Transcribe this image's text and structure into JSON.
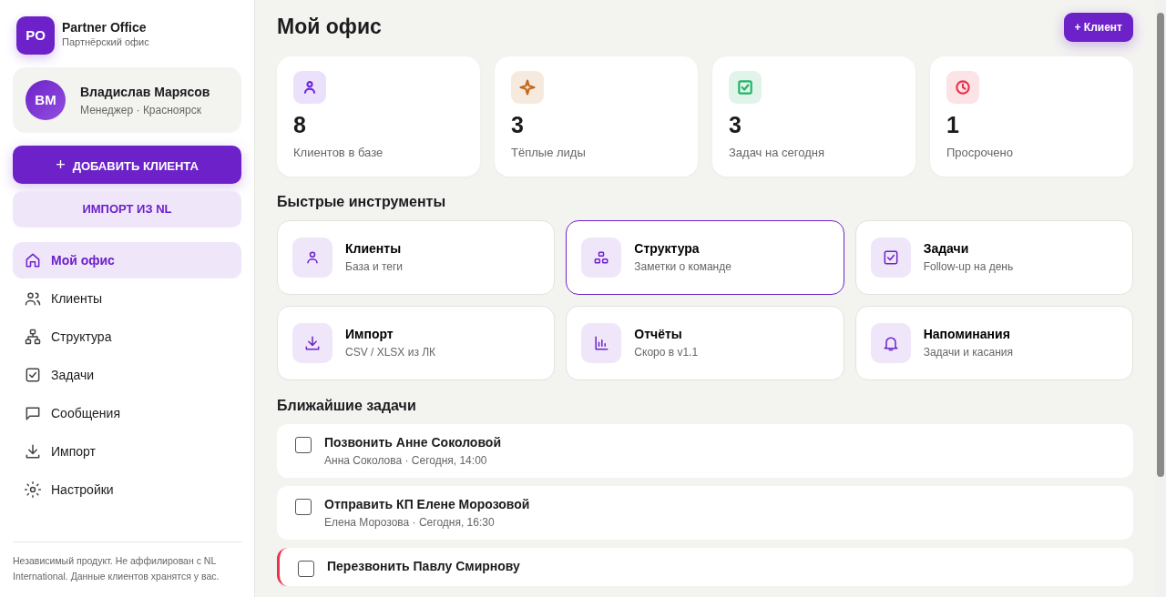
{
  "brand": {
    "logo": "PO",
    "name": "Partner Office",
    "subtitle": "Партнёрский офис"
  },
  "user": {
    "initials": "ВМ",
    "name": "Владислав Марясов",
    "role": "Менеджер · Красноярск"
  },
  "add_client_button": {
    "icon": "+",
    "label": "ДОБАВИТЬ КЛИЕНТА"
  },
  "import_button": {
    "label": "ИМПОРТ ИЗ NL"
  },
  "nav": [
    {
      "label": "Мой офис",
      "selected": true
    },
    {
      "label": "Клиенты",
      "selected": false
    },
    {
      "label": "Структура",
      "selected": false
    },
    {
      "label": "Задачи",
      "selected": false
    },
    {
      "label": "Сообщения",
      "selected": false
    },
    {
      "label": "Импорт",
      "selected": false
    },
    {
      "label": "Настройки",
      "selected": false
    }
  ],
  "disclaimer": "Независимый продукт. Не аффилирован с NL International. Данные клиентов хранятся у вас.",
  "page_title": "Мой офис",
  "header_button": "+ Клиент",
  "stats": [
    {
      "value": "8",
      "label": "Клиентов в базе",
      "color": "#6d28d9"
    },
    {
      "value": "3",
      "label": "Тёплые лиды",
      "color": "#c2691a"
    },
    {
      "value": "3",
      "label": "Задач на сегодня",
      "color": "#22b366"
    },
    {
      "value": "1",
      "label": "Просрочено",
      "color": "#e8344e"
    }
  ],
  "tools_title": "Быстрые инструменты",
  "tools": [
    {
      "title": "Клиенты",
      "subtitle": "База и теги",
      "selected": false
    },
    {
      "title": "Структура",
      "subtitle": "Заметки о команде",
      "selected": true
    },
    {
      "title": "Задачи",
      "subtitle": "Follow-up на день",
      "selected": false
    },
    {
      "title": "Импорт",
      "subtitle": "CSV / XLSX из ЛК",
      "selected": false
    },
    {
      "title": "Отчёты",
      "subtitle": "Скоро в v1.1",
      "selected": false
    },
    {
      "title": "Напоминания",
      "subtitle": "Задачи и касания",
      "selected": false
    }
  ],
  "tasks_title": "Ближайшие задачи",
  "tasks": [
    {
      "title": "Позвонить Анне Соколовой",
      "meta": "Анна Соколова · Сегодня, 14:00",
      "checked": false,
      "overdue": false
    },
    {
      "title": "Отправить КП Елене Морозовой",
      "meta": "Елена Морозова · Сегодня, 16:30",
      "checked": false,
      "overdue": false
    },
    {
      "title": "Перезвонить Павлу Смирнову",
      "checked": false,
      "overdue": true
    }
  ]
}
